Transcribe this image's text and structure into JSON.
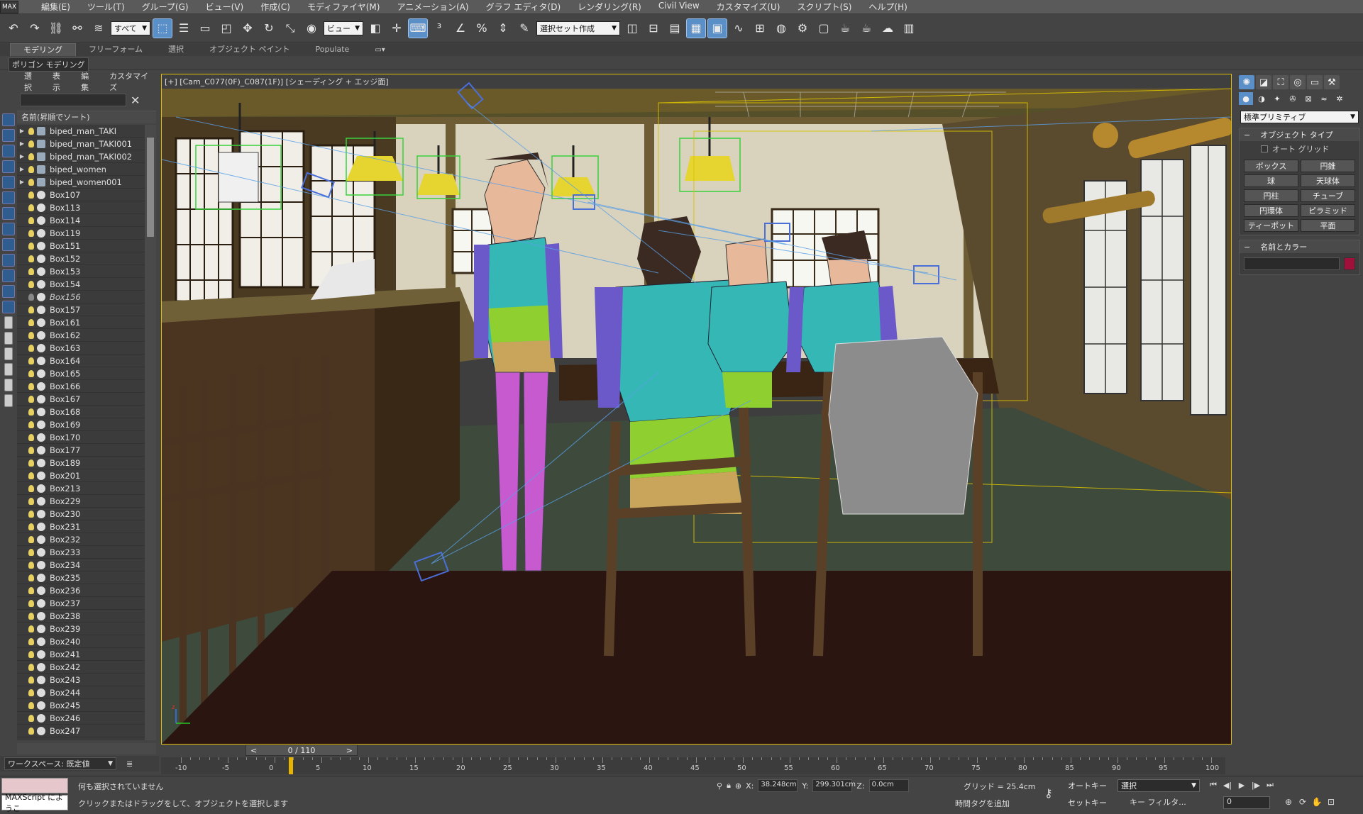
{
  "menu": {
    "logo": "MAX",
    "items": [
      "編集(E)",
      "ツール(T)",
      "グループ(G)",
      "ビュー(V)",
      "作成(C)",
      "モディファイヤ(M)",
      "アニメーション(A)",
      "グラフ エディタ(D)",
      "レンダリング(R)",
      "Civil View",
      "カスタマイズ(U)",
      "スクリプト(S)",
      "ヘルプ(H)"
    ]
  },
  "toolbar": {
    "filter": "すべて",
    "refcoord": "ビュー",
    "selset": "選択セット作成"
  },
  "ribbon": {
    "tabs": [
      "モデリング",
      "フリーフォーム",
      "選択",
      "オブジェクト ペイント",
      "Populate"
    ],
    "sub": "ポリゴン モデリング"
  },
  "scene": {
    "tabs": [
      "選択",
      "表示",
      "編集",
      "カスタマイズ"
    ],
    "header": "名前(昇順でソート)",
    "items": [
      {
        "n": "biped_man_TAKI",
        "t": "bip",
        "e": true
      },
      {
        "n": "biped_man_TAKI001",
        "t": "bip",
        "e": true
      },
      {
        "n": "biped_man_TAKI002",
        "t": "bip",
        "e": true
      },
      {
        "n": "biped_women",
        "t": "bip",
        "e": true
      },
      {
        "n": "biped_women001",
        "t": "bip",
        "e": true
      },
      {
        "n": "Box107"
      },
      {
        "n": "Box113"
      },
      {
        "n": "Box114"
      },
      {
        "n": "Box119"
      },
      {
        "n": "Box151"
      },
      {
        "n": "Box152"
      },
      {
        "n": "Box153"
      },
      {
        "n": "Box154"
      },
      {
        "n": "Box156",
        "h": true
      },
      {
        "n": "Box157"
      },
      {
        "n": "Box161"
      },
      {
        "n": "Box162"
      },
      {
        "n": "Box163"
      },
      {
        "n": "Box164"
      },
      {
        "n": "Box165"
      },
      {
        "n": "Box166"
      },
      {
        "n": "Box167"
      },
      {
        "n": "Box168"
      },
      {
        "n": "Box169"
      },
      {
        "n": "Box170"
      },
      {
        "n": "Box177"
      },
      {
        "n": "Box189"
      },
      {
        "n": "Box201"
      },
      {
        "n": "Box213"
      },
      {
        "n": "Box229"
      },
      {
        "n": "Box230"
      },
      {
        "n": "Box231"
      },
      {
        "n": "Box232"
      },
      {
        "n": "Box233"
      },
      {
        "n": "Box234"
      },
      {
        "n": "Box235"
      },
      {
        "n": "Box236"
      },
      {
        "n": "Box237"
      },
      {
        "n": "Box238"
      },
      {
        "n": "Box239"
      },
      {
        "n": "Box240"
      },
      {
        "n": "Box241"
      },
      {
        "n": "Box242"
      },
      {
        "n": "Box243"
      },
      {
        "n": "Box244"
      },
      {
        "n": "Box245"
      },
      {
        "n": "Box246"
      },
      {
        "n": "Box247"
      }
    ]
  },
  "workspace": "ワークスペース: 既定値",
  "viewport": {
    "label": "[+] [Cam_C077(0F)_C087(1F)] [シェーディング + エッジ面]"
  },
  "cmd": {
    "dropdown": "標準プリミティブ",
    "objtype": "オブジェクト タイプ",
    "autogrid": "オート グリッド",
    "buttons": [
      "ボックス",
      "円錐",
      "球",
      "天球体",
      "円柱",
      "チューブ",
      "円環体",
      "ピラミッド",
      "ティーポット",
      "平面"
    ],
    "namecolor": "名前とカラー",
    "swatch": "#a0103a"
  },
  "time": {
    "slider": "0 / 110",
    "labels": [
      "-10",
      "-5",
      "0",
      "5",
      "10",
      "15",
      "20",
      "25",
      "30",
      "35",
      "40",
      "45",
      "50",
      "55",
      "60",
      "65",
      "70",
      "75",
      "80",
      "85",
      "90",
      "95",
      "100"
    ]
  },
  "status": {
    "maxscript": "MAXScript にようこ",
    "line1": "何も選択されていません",
    "line2": "クリックまたはドラッグをして、オブジェクトを選択します",
    "x": "38.248cm",
    "y": "299.301cm",
    "z": "0.0cm",
    "grid": "グリッド = 25.4cm",
    "addtag": "時間タグを追加",
    "autokey": "オートキー",
    "setkey": "セットキー",
    "selection": "選択",
    "keyfilter": "キー フィルタ...",
    "frame": "0"
  }
}
